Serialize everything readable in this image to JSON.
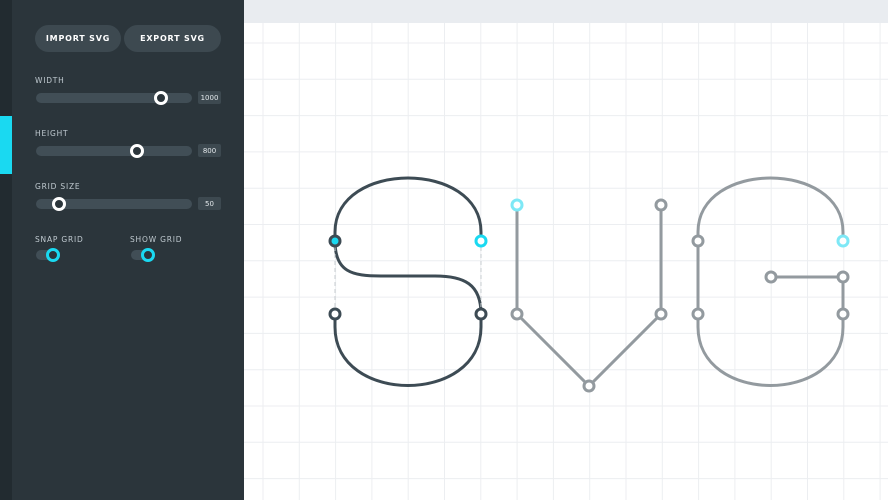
{
  "sidebar": {
    "import_label": "IMPORT SVG",
    "export_label": "EXPORT SVG",
    "width": {
      "label": "WIDTH",
      "value": "1000",
      "level": 0.8
    },
    "height": {
      "label": "HEIGHT",
      "value": "800",
      "level": 0.65
    },
    "grid_size": {
      "label": "GRID SIZE",
      "value": "50",
      "level": 0.15
    },
    "snap_grid": {
      "label": "SNAP GRID",
      "on": true
    },
    "show_grid": {
      "label": "SHOW GRID",
      "on": true
    }
  },
  "colors": {
    "sidebar_bg": "#2b353b",
    "accent": "#1ad9f1",
    "path_active": "#3d4b54",
    "path_inactive": "#939a9f",
    "grid_line": "#eceef1"
  },
  "canvas": {
    "letters": [
      "S",
      "V",
      "G"
    ]
  }
}
